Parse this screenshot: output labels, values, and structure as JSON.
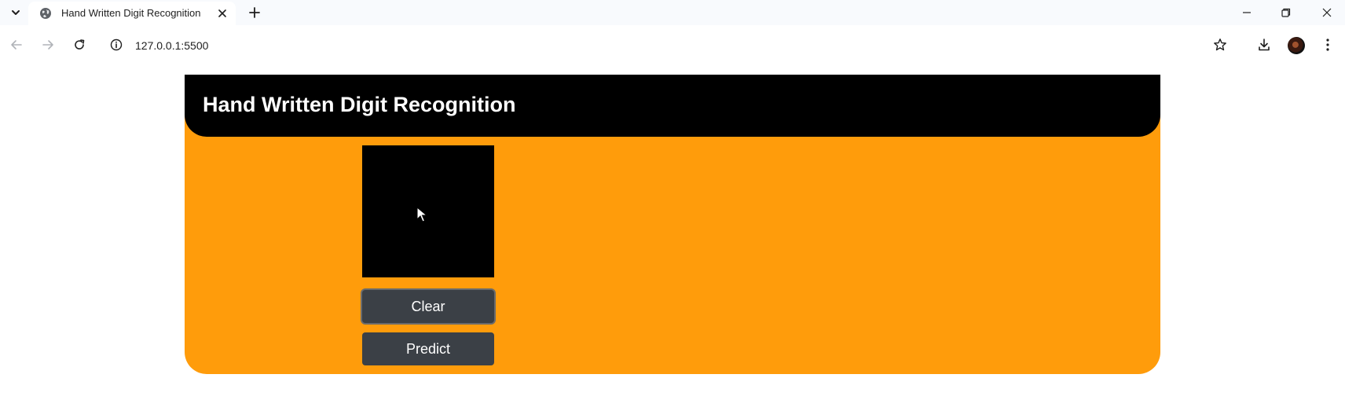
{
  "browser": {
    "tab_title": "Hand Written Digit Recognition",
    "url": "127.0.0.1:5500",
    "icons": {
      "tab_search": "chevron-down-icon",
      "favicon": "globe-icon",
      "tab_close": "close-icon",
      "new_tab": "plus-icon",
      "minimize": "minimize-icon",
      "restore": "restore-icon",
      "close_window": "close-icon",
      "back": "arrow-left-icon",
      "forward": "arrow-right-icon",
      "reload": "reload-icon",
      "site_info": "info-icon",
      "bookmark": "star-icon",
      "downloads": "download-icon",
      "profile": "avatar",
      "menu": "kebab-menu-icon"
    }
  },
  "app": {
    "title": "Hand Written Digit Recognition",
    "clear_label": "Clear",
    "predict_label": "Predict",
    "colors": {
      "card_background": "#ff9c0b",
      "header_background": "#000000",
      "canvas_background": "#000000",
      "button_background": "#3b4046",
      "button_text": "#ffffff"
    }
  }
}
